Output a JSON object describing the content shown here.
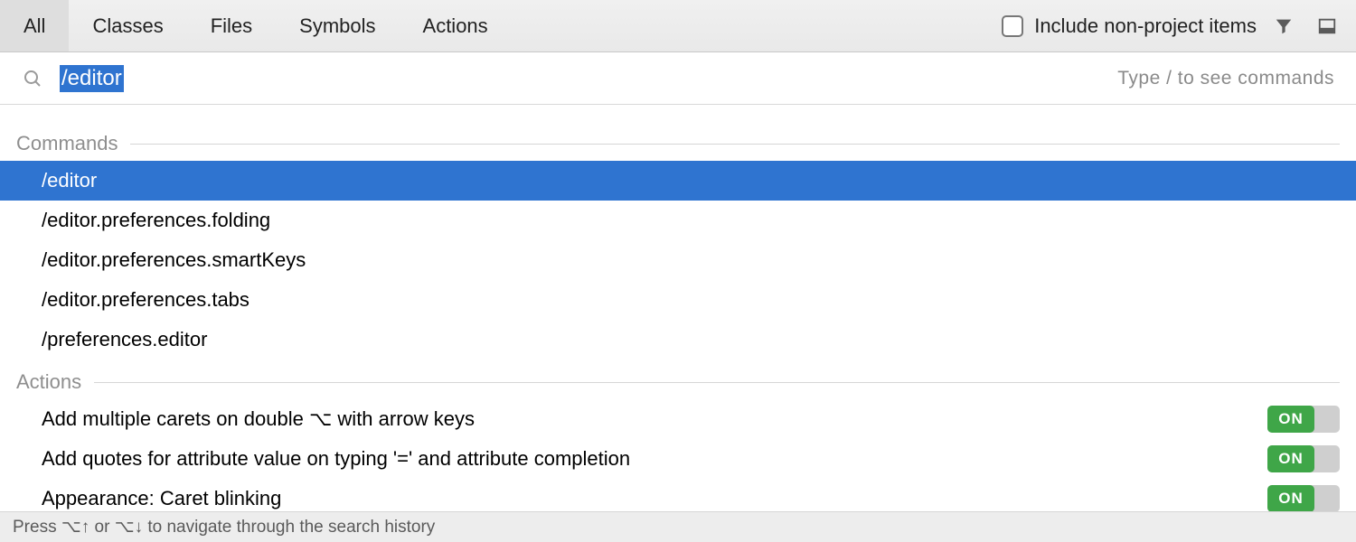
{
  "tabs": {
    "items": [
      {
        "label": "All",
        "active": true
      },
      {
        "label": "Classes",
        "active": false
      },
      {
        "label": "Files",
        "active": false
      },
      {
        "label": "Symbols",
        "active": false
      },
      {
        "label": "Actions",
        "active": false
      }
    ],
    "include_label": "Include non-project items",
    "include_checked": false
  },
  "search": {
    "query": "/editor",
    "hint": "Type / to see commands"
  },
  "sections": {
    "commands_label": "Commands",
    "actions_label": "Actions"
  },
  "commands": [
    {
      "label": "/editor",
      "selected": true
    },
    {
      "label": "/editor.preferences.folding",
      "selected": false
    },
    {
      "label": "/editor.preferences.smartKeys",
      "selected": false
    },
    {
      "label": "/editor.preferences.tabs",
      "selected": false
    },
    {
      "label": "/preferences.editor",
      "selected": false
    }
  ],
  "actions": [
    {
      "label": "Add multiple carets on double ⌥ with arrow keys",
      "state": "ON"
    },
    {
      "label": "Add quotes for attribute value on typing '=' and attribute completion",
      "state": "ON"
    },
    {
      "label": "Appearance: Caret blinking",
      "state": "ON"
    }
  ],
  "statusbar": {
    "text": "Press ⌥↑ or ⌥↓ to navigate through the search history"
  },
  "colors": {
    "selection": "#2f74d0",
    "toggle_on": "#3fa648"
  }
}
